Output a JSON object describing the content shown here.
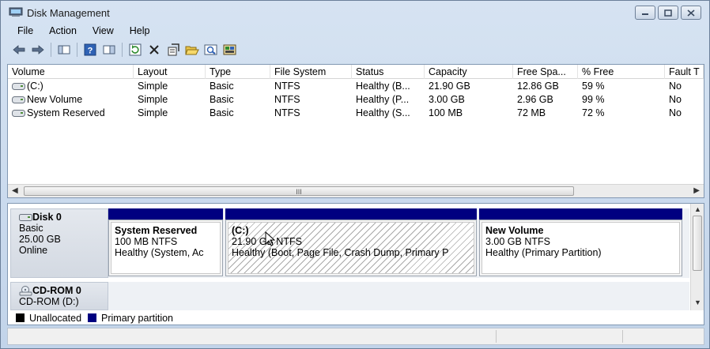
{
  "window": {
    "title": "Disk Management",
    "icon": "disk-management-icon"
  },
  "menu": [
    "File",
    "Action",
    "View",
    "Help"
  ],
  "toolbar": {
    "icons": [
      "back-arrow-icon",
      "forward-arrow-icon",
      "console-tree-icon",
      "help-icon",
      "show-pane-icon",
      "refresh-icon",
      "delete-icon",
      "properties-icon",
      "open-folder-icon",
      "magnifier-icon",
      "disk-map-icon"
    ]
  },
  "volume_list": {
    "columns": [
      "Volume",
      "Layout",
      "Type",
      "File System",
      "Status",
      "Capacity",
      "Free Spa...",
      "% Free",
      "Fault T"
    ],
    "rows": [
      {
        "volume": "(C:)",
        "layout": "Simple",
        "type": "Basic",
        "fs": "NTFS",
        "status": "Healthy (B...",
        "capacity": "21.90 GB",
        "free": "12.86 GB",
        "pct": "59 %",
        "fault": "No"
      },
      {
        "volume": "New Volume",
        "layout": "Simple",
        "type": "Basic",
        "fs": "NTFS",
        "status": "Healthy (P...",
        "capacity": "3.00 GB",
        "free": "2.96 GB",
        "pct": "99 %",
        "fault": "No"
      },
      {
        "volume": "System Reserved",
        "layout": "Simple",
        "type": "Basic",
        "fs": "NTFS",
        "status": "Healthy (S...",
        "capacity": "100 MB",
        "free": "72 MB",
        "pct": "72 %",
        "fault": "No"
      }
    ],
    "scroll_grip": "III"
  },
  "disks": [
    {
      "name": "Disk 0",
      "type": "Basic",
      "size": "25.00 GB",
      "state": "Online",
      "partitions": [
        {
          "title": "System Reserved",
          "size": "100 MB NTFS",
          "status": "Healthy (System, Ac"
        },
        {
          "title": "(C:)",
          "size": "21.90 GB NTFS",
          "status": "Healthy (Boot, Page File, Crash Dump, Primary P"
        },
        {
          "title": "New Volume",
          "size": "3.00 GB NTFS",
          "status": "Healthy (Primary Partition)"
        }
      ]
    },
    {
      "name": "CD-ROM 0",
      "type": "CD-ROM (D:)"
    }
  ],
  "legend": [
    {
      "label": "Unallocated",
      "color": "#000000"
    },
    {
      "label": "Primary partition",
      "color": "#000080"
    }
  ]
}
